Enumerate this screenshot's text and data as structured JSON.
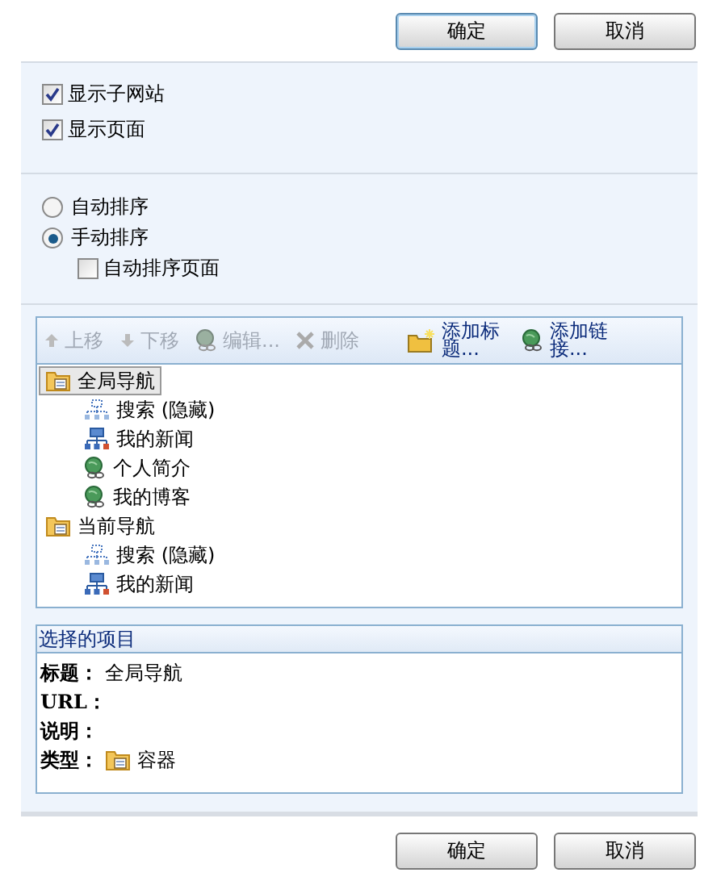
{
  "top_buttons": [
    "确定",
    "取消"
  ],
  "display_options": [
    {
      "label": "显示子网站",
      "checked": true
    },
    {
      "label": "显示页面",
      "checked": true
    }
  ],
  "sort_options": [
    {
      "label": "自动排序",
      "selected": false
    },
    {
      "label": "手动排序",
      "selected": true
    }
  ],
  "sort_pages": {
    "label": "自动排序页面",
    "checked": false
  },
  "toolbar": [
    {
      "kind": "up",
      "label": "上移",
      "disabled": true
    },
    {
      "kind": "down",
      "label": "下移",
      "disabled": true
    },
    {
      "kind": "edit",
      "label": "编辑...",
      "disabled": true
    },
    {
      "kind": "delete",
      "label": "删除",
      "disabled": true
    },
    {
      "kind": "heading",
      "label": "添加标题...",
      "disabled": false
    },
    {
      "kind": "link",
      "label": "添加链接...",
      "disabled": false
    }
  ],
  "tree": [
    {
      "kind": "container",
      "label": "全局导航",
      "selected": true,
      "children": [
        {
          "kind": "hidden",
          "label": "搜索 (隐藏)",
          "selected": false
        },
        {
          "kind": "page",
          "label": "我的新闻",
          "selected": false
        },
        {
          "kind": "link",
          "label": "个人简介",
          "selected": false
        },
        {
          "kind": "link",
          "label": "我的博客",
          "selected": false
        }
      ]
    },
    {
      "kind": "container",
      "label": "当前导航",
      "selected": false,
      "children": [
        {
          "kind": "hidden",
          "label": "搜索 (隐藏)",
          "selected": false
        },
        {
          "kind": "page",
          "label": "我的新闻",
          "selected": false
        }
      ]
    }
  ],
  "selected_item": {
    "title": "选择的项目",
    "fields": [
      {
        "label": "标题：",
        "value": "全局导航"
      },
      {
        "label": "URL："
      },
      {
        "label": "说明："
      },
      {
        "label": "类型：",
        "kind": "container",
        "value": "容器"
      }
    ]
  },
  "bottom_buttons": [
    "确定",
    "取消"
  ]
}
